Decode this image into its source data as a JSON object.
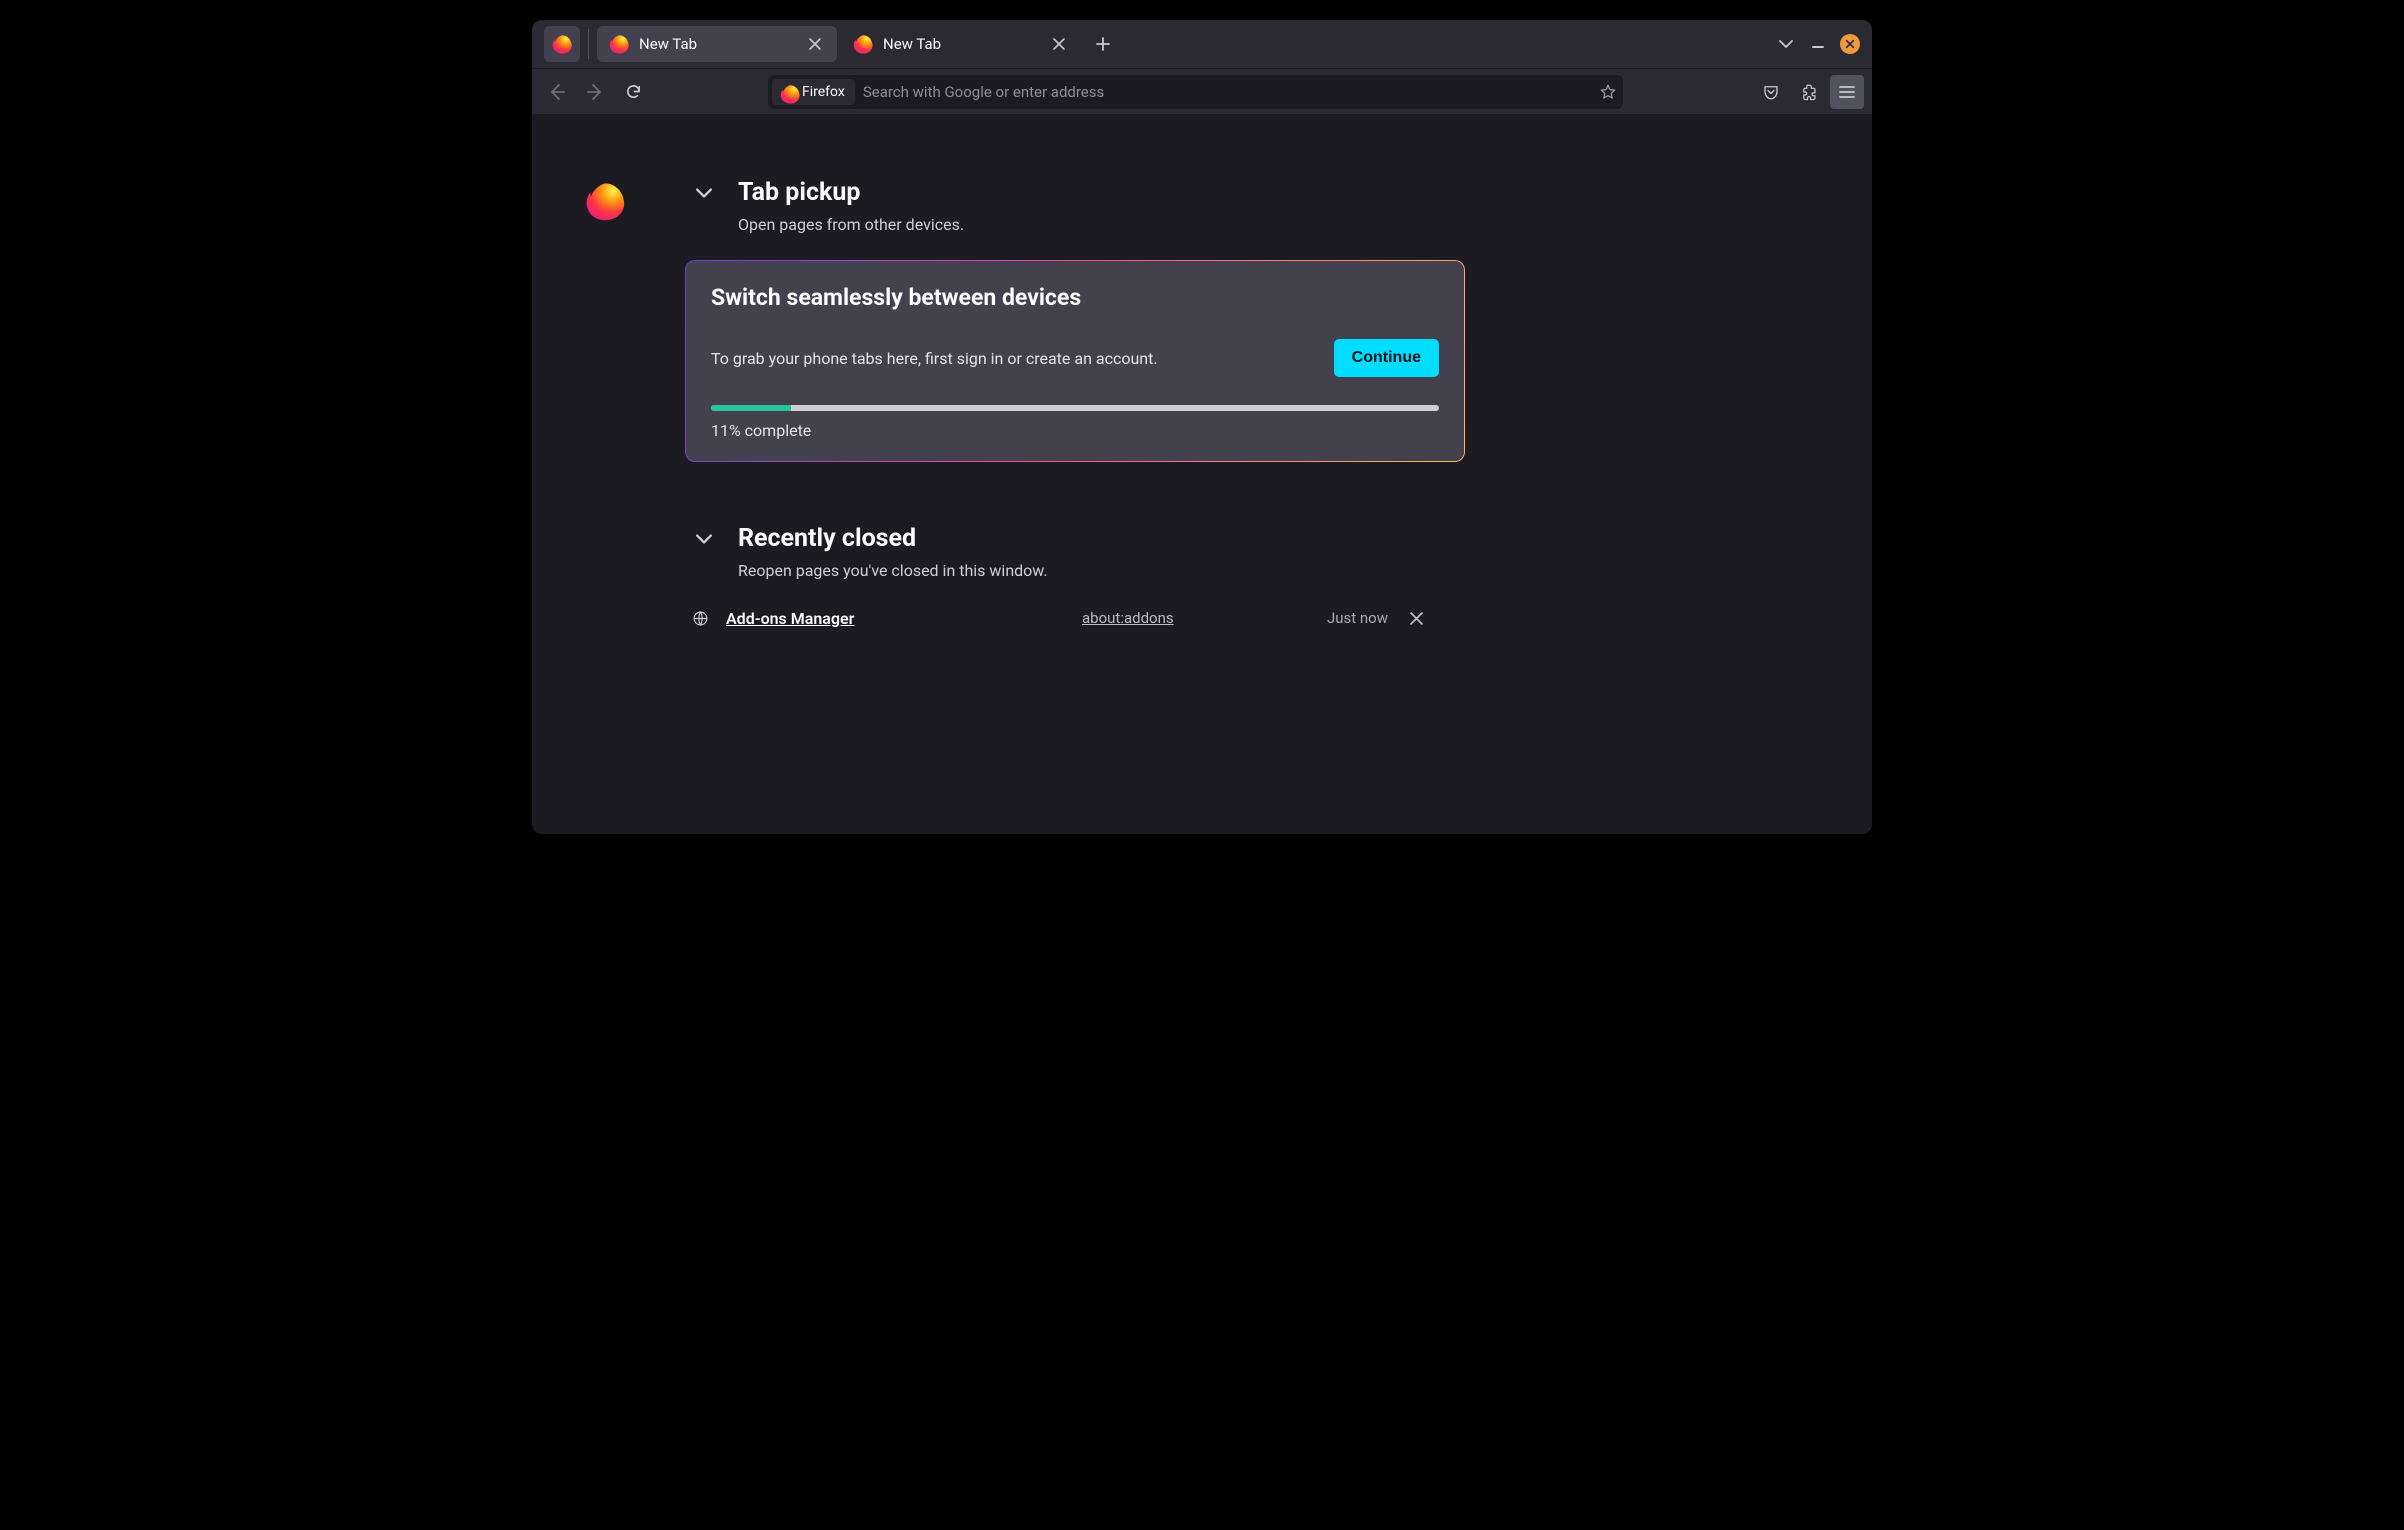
{
  "tabs": [
    {
      "label": "New Tab",
      "active": true
    },
    {
      "label": "New Tab",
      "active": false
    }
  ],
  "urlbar": {
    "identity_label": "Firefox",
    "placeholder": "Search with Google or enter address"
  },
  "pickup": {
    "title": "Tab pickup",
    "subtitle": "Open pages from other devices.",
    "card_title": "Switch seamlessly between devices",
    "card_desc": "To grab your phone tabs here, first sign in or create an account.",
    "continue_label": "Continue",
    "progress_percent": 11,
    "progress_text": "11% complete"
  },
  "recent": {
    "title": "Recently closed",
    "subtitle": "Reopen pages you've closed in this window.",
    "items": [
      {
        "name": "Add-ons Manager",
        "url": "about:addons",
        "time": "Just now"
      }
    ]
  }
}
